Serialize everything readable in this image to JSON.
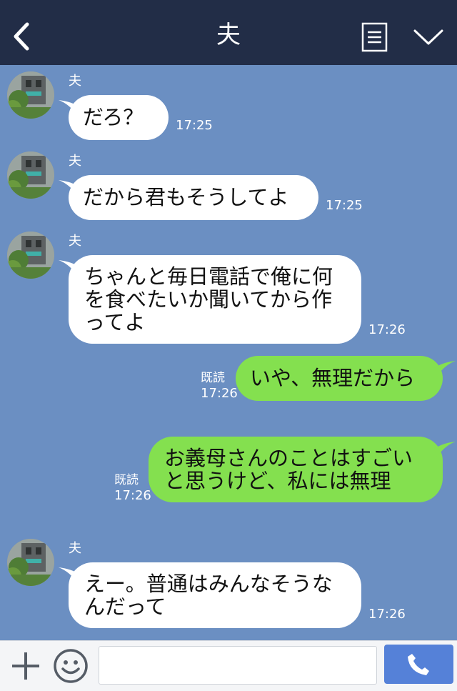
{
  "header": {
    "title": "夫",
    "back_icon": "chevron-left-icon",
    "menu_icon": "list-icon",
    "dropdown_icon": "chevron-down-icon"
  },
  "messages": [
    {
      "direction": "in",
      "sender": "夫",
      "lines": [
        "だろ？"
      ],
      "time": "17:25"
    },
    {
      "direction": "in",
      "sender": "夫",
      "lines": [
        "だから君もそうしてよ"
      ],
      "time": "17:25"
    },
    {
      "direction": "in",
      "sender": "夫",
      "lines": [
        "ちゃんと毎日電話で俺に何",
        "を食べたいか聞いてから作",
        "ってよ"
      ],
      "time": "17:26"
    },
    {
      "direction": "out",
      "read": "既読",
      "lines": [
        "いや、無理だから"
      ],
      "time": "17:26"
    },
    {
      "direction": "out",
      "read": "既読",
      "lines": [
        "お義母さんのことはすごい",
        "と思うけど、私には無理"
      ],
      "time": "17:26"
    },
    {
      "direction": "in",
      "sender": "夫",
      "lines": [
        "えー。普通はみんなそうな",
        "んだって"
      ],
      "time": "17:26"
    }
  ],
  "footer": {
    "plus_icon": "plus-icon",
    "emoji_icon": "smiley-icon",
    "input_value": "",
    "call_icon": "phone-icon"
  },
  "colors": {
    "background": "#6b8fc2",
    "header": "#222d47",
    "incoming_bubble": "#ffffff",
    "outgoing_bubble": "#84e04f",
    "call_button": "#5581d8"
  }
}
